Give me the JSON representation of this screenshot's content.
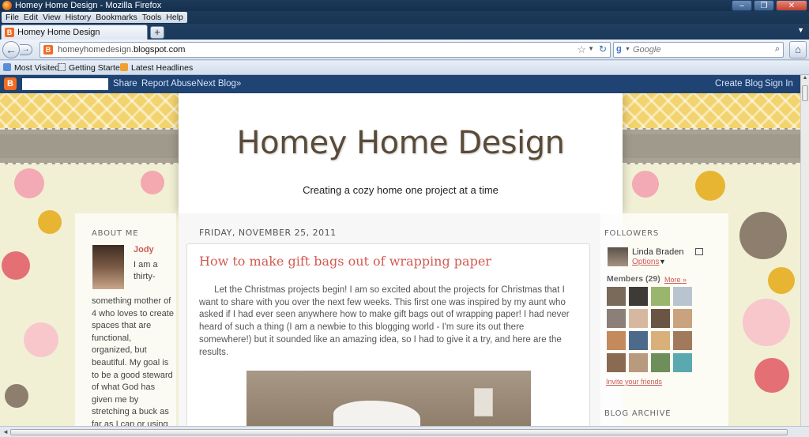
{
  "window": {
    "title": "Homey Home Design - Mozilla Firefox"
  },
  "menu": [
    "File",
    "Edit",
    "View",
    "History",
    "Bookmarks",
    "Tools",
    "Help"
  ],
  "tab": {
    "label": "Homey Home Design",
    "new_tab": "+"
  },
  "address": {
    "url_prefix": "homeyhomedesign.",
    "url_domain": "blogspot.com"
  },
  "search": {
    "engine_letter": "g",
    "placeholder": "Google"
  },
  "bookmarks": [
    "Most Visited",
    "Getting Started",
    "Latest Headlines"
  ],
  "blogger_nav": {
    "logo": "B",
    "links": [
      "Share",
      "Report Abuse",
      "Next Blog»"
    ],
    "right_links": [
      "Create Blog",
      "Sign In"
    ]
  },
  "header": {
    "title": "Homey Home Design",
    "tagline": "Creating a cozy home one project at a time"
  },
  "post": {
    "date": "FRIDAY, NOVEMBER 25, 2011",
    "title": "How to make gift bags out of wrapping paper",
    "body": "Let the Christmas projects begin! I am so excited about the projects for Christmas that I want to share with you over the next few weeks. This first one was inspired by my aunt who asked if I had ever seen anywhere how to make gift bags out of wrapping paper! I had never heard of such a thing (I am a newbie to this blogging world - I'm sure its out there somewhere!) but it sounded like an amazing idea, so I had to give it a try, and here are the results."
  },
  "about": {
    "heading": "ABOUT ME",
    "name": "Jody",
    "text_top": "I am a thirty-",
    "text_rest": "something mother of 4 who loves to create spaces that are functional, organized, but beautiful. My goal is to be a good steward of what God has given me by stretching a buck as far as I can or using what I already have. For me, decorating is"
  },
  "followers": {
    "heading": "FOLLOWERS",
    "top_follower": "Linda Braden",
    "options": "Options",
    "members": "Members (29)",
    "more": "More »",
    "invite": "Invite your friends",
    "archive_heading": "BLOG ARCHIVE"
  },
  "colors": {
    "accent": "#c95d57",
    "blogger_bar": "#1f4372",
    "title": "#5a4a38"
  }
}
